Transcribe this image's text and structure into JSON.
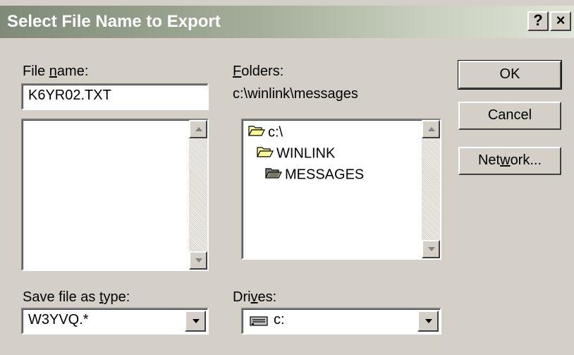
{
  "window": {
    "title": "Select File Name to Export",
    "help_label": "?",
    "close_label": "×"
  },
  "file_name": {
    "label_prefix": "File ",
    "label_key": "n",
    "label_suffix": "ame:",
    "value": "K6YR02.TXT",
    "list_items": []
  },
  "folders": {
    "label_key": "F",
    "label_suffix": "olders:",
    "current_path": "c:\\winlink\\messages",
    "tree": [
      {
        "label": "c:\\",
        "state": "open"
      },
      {
        "label": "WINLINK",
        "state": "open"
      },
      {
        "label": "MESSAGES",
        "state": "selected"
      }
    ]
  },
  "save_type": {
    "label_prefix": "Save file as ",
    "label_key": "t",
    "label_suffix": "ype:",
    "value": "W3YVQ.*"
  },
  "drives": {
    "label_prefix": "Dri",
    "label_key": "v",
    "label_suffix": "es:",
    "value": "c:",
    "icon": "drive-icon"
  },
  "buttons": {
    "ok": "OK",
    "cancel": "Cancel",
    "network_prefix": "Net",
    "network_key": "w",
    "network_suffix": "ork..."
  },
  "colors": {
    "dialog_bg": "#d4d0c8",
    "titlebar_start": "#7f8a78",
    "titlebar_end": "#dfe4d7",
    "folder_fill": "#ffff99"
  }
}
